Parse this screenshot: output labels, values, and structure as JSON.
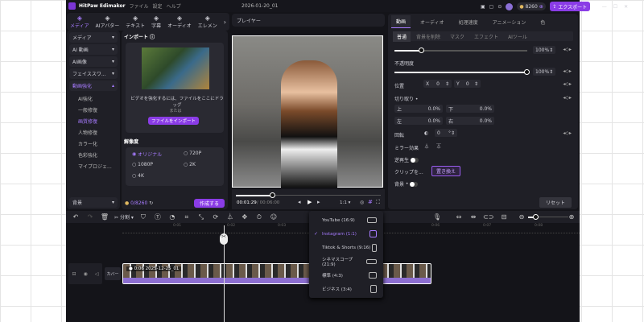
{
  "app": {
    "name": "HitPaw Edimakor",
    "project": "2026-01-20_01",
    "menu": [
      "ファイル",
      "設定",
      "ヘルプ"
    ],
    "credits": "8260",
    "export": "エクスポート",
    "accent": "#8a3ce6"
  },
  "tabs": [
    {
      "label": "メディア",
      "icon": "media-icon",
      "active": true
    },
    {
      "label": "AIアバター",
      "icon": "avatar-icon"
    },
    {
      "label": "テキスト",
      "icon": "text-icon"
    },
    {
      "label": "字幕",
      "icon": "subtitle-icon"
    },
    {
      "label": "オーディオ",
      "icon": "audio-icon"
    },
    {
      "label": "エレメン",
      "icon": "element-icon"
    }
  ],
  "sidebar": {
    "groups": [
      "メディア",
      "AI 動画",
      "AI画像",
      "フェイススワ...",
      "動画強化"
    ],
    "sub": [
      "AI強化",
      "一般修復",
      "画質修復",
      "人物修復",
      "カラー化",
      "色彩強化",
      "マイプロジェ..."
    ],
    "active_sub": 2,
    "bottom": "背景"
  },
  "import": {
    "title": "インポート",
    "hint": "ビデオを強化するには、ファイルをここにドラッグ",
    "or": "または",
    "button": "ファイルをインポート",
    "resolution_title": "解像度",
    "options": [
      "オリジナル",
      "720P",
      "1080P",
      "2K",
      "4K"
    ],
    "selected": "オリジナル",
    "cost": "0/8260",
    "create": "作成する"
  },
  "player": {
    "title": "プレイヤー",
    "time": "00:01:29",
    "duration": "00:06:00",
    "ratio": "1:1",
    "progress": 0.25
  },
  "right": {
    "tabs": [
      "動画",
      "オーディオ",
      "処理速度",
      "アニメーション",
      "色"
    ],
    "subtabs": [
      "普通",
      "背景を削除",
      "マスク",
      "エフェクト",
      "AIツール"
    ],
    "scale": "100%",
    "scale_frac": 0.2,
    "opacity_label": "不透明度",
    "opacity": "100%",
    "position_label": "位置",
    "x": "0",
    "y": "0",
    "crop_label": "切り取り",
    "crop": [
      {
        "l": "上",
        "v": "0.0%"
      },
      {
        "l": "下",
        "v": "0.0%"
      },
      {
        "l": "左",
        "v": "0.0%"
      },
      {
        "l": "右",
        "v": "0.0%"
      }
    ],
    "rotate_label": "回転",
    "rotate": "0",
    "mirror": "ミラー効果",
    "reverse": "逆再生",
    "clip": "クリップを...",
    "replace": "置き換え",
    "bg": "背景",
    "reset": "リセット"
  },
  "timeline": {
    "split": "分割",
    "ticks": [
      "0:01",
      "0:02",
      "0:03",
      "0:06",
      "0:07",
      "0:08"
    ],
    "clip_label": "0:06 2025-12-25_01",
    "cover": "カバー"
  },
  "ratio_menu": [
    {
      "label": "YouTube (16:9)",
      "w": 12,
      "h": 7
    },
    {
      "label": "Instagram (1:1)",
      "w": 9,
      "h": 9,
      "checked": true
    },
    {
      "label": "Tiktok & Shorts (9:16)",
      "w": 6,
      "h": 10
    },
    {
      "label": "シネマスコープ (21:9)",
      "w": 13,
      "h": 6
    },
    {
      "label": "標準 (4:3)",
      "w": 10,
      "h": 8
    },
    {
      "label": "ビジネス (3:4)",
      "w": 8,
      "h": 10
    }
  ]
}
